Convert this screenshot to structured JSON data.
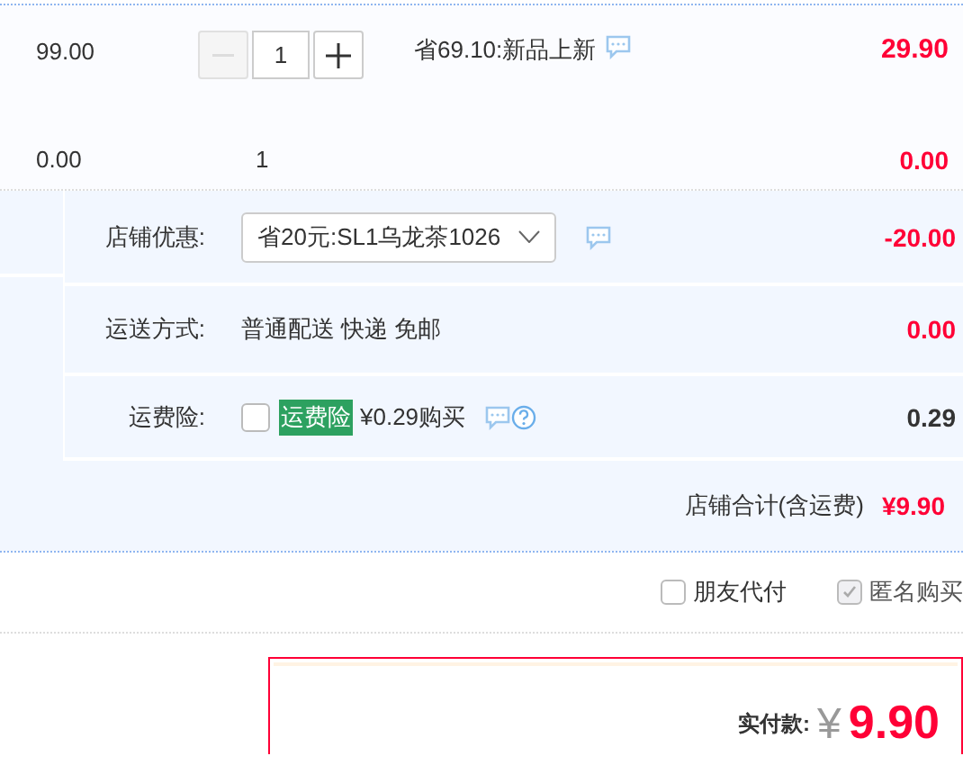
{
  "item": {
    "unit_price": "99.00",
    "decrease_disabled": true,
    "quantity": "1",
    "promotion": "省69.10:新品上新",
    "subtotal": "29.90"
  },
  "gift_row": {
    "unit_price": "0.00",
    "quantity": "1",
    "subtotal": "0.00"
  },
  "store": {
    "coupon": {
      "label": "店铺优惠:",
      "value": "省20元:SL1乌龙茶1026",
      "amount": "-20.00"
    },
    "shipping": {
      "label": "运送方式:",
      "value": "普通配送 快递 免邮",
      "amount": "0.00"
    },
    "insurance": {
      "label": "运费险:",
      "checked": false,
      "tag": "运费险",
      "price": "¥0.29购买",
      "amount": "0.29"
    },
    "total": {
      "label": "店铺合计(含运费)",
      "amount": "¥9.90"
    }
  },
  "options": [
    {
      "label": "朋友代付",
      "checked": false,
      "disabled": false
    },
    {
      "label": "匿名购买",
      "checked": true,
      "disabled": true
    }
  ],
  "payment": {
    "label": "实付款:",
    "currency": "¥",
    "amount": "9.90"
  }
}
